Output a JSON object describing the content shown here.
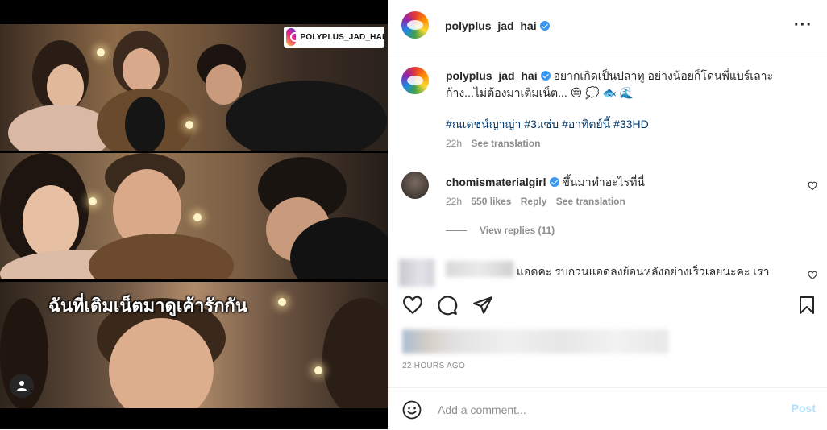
{
  "post": {
    "author": "polyplus_jad_hai",
    "watermark": "POLYPLUS_JAD_HAI",
    "overlay_caption": "ฉันที่เติมเน็ตมาดูเค้ารักกัน",
    "more_icon": "more-horizontal-icon"
  },
  "caption": {
    "username": "polyplus_jad_hai",
    "text_line1": "อยากเกิดเป็นปลาทู อย่างน้อยก็โดนพี่แบร์เลาะ",
    "text_line2": "ก้าง...ไม่ต้องมาเติมเน็ต...",
    "emoji": "😔 💭 🐟 🌊",
    "hashtags": "#ณเดชน์ญาญ่า #3แซ่บ #อาทิตย์นี้ #33HD",
    "time": "22h",
    "see_translation": "See translation"
  },
  "comments": [
    {
      "username": "chomismaterialgirl",
      "text": "ขึ้นมาทำอะไรที่นี่",
      "time": "22h",
      "likes": "550 likes",
      "reply": "Reply",
      "see_translation": "See translation",
      "view_replies": "View replies (11)"
    },
    {
      "text": "แอดคะ รบกวนแอดลงย้อนหลังอย่างเร็วเลยนะคะ เรา"
    }
  ],
  "post_time": "22 HOURS AGO",
  "footer": {
    "placeholder": "Add a comment...",
    "post_label": "Post"
  },
  "colors": {
    "verified": "#3897f0",
    "hashtag": "#00376b",
    "post_button": "#b2dffc",
    "meta": "#8e8e8e"
  }
}
